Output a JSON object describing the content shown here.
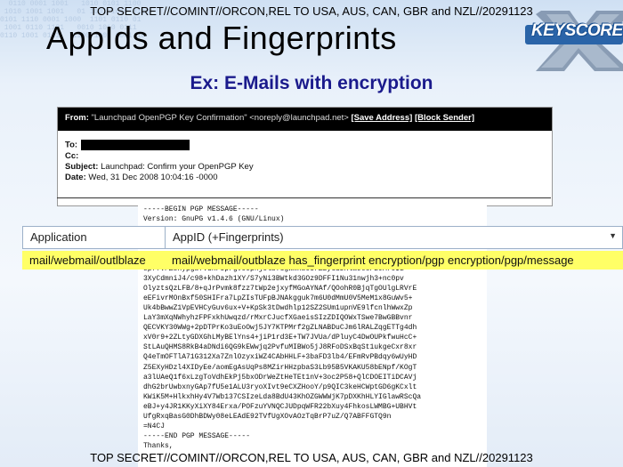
{
  "classification": "TOP SECRET//COMINT//ORCON,REL TO USA, AUS, CAN, GBR and NZL//20291123",
  "title": "AppIds and Fingerprints",
  "subtitle": "Ex: E-Mails with encryption",
  "logo": {
    "text": "KEYSCORE",
    "icon": "keyscore-x-logo"
  },
  "email": {
    "from_label": "From:",
    "from_value": "\"Launchpad OpenPGP Key Confirmation\" <noreply@launchpad.net>",
    "save_address": "[Save Address]",
    "block_sender": "[Block Sender]",
    "to_label": "To:",
    "cc_label": "Cc:",
    "subject_label": "Subject:",
    "subject_value": "Launchpad: Confirm your OpenPGP Key",
    "date_label": "Date:",
    "date_value": "Wed, 31 Dec 2008 10:04:16 -0000"
  },
  "grid": {
    "headers": [
      "Application",
      "AppID (+Fingerprints)"
    ],
    "row": [
      "mail/webmail/outlblaze",
      "mail/webmail/outblaze has_fingerprint encryption/pgp encryption/pgp/message"
    ]
  },
  "pgp_lines": [
    "-----BEGIN PGP MESSAGE-----",
    "Version: GnuPG v1.4.6 (GNU/Linux)",
    "",
    "",
    "",
    "",
    "spffVPZsHypgb7VdHFUprgvOJpnjOlb73gWmhbOUrZzyGdDRla9CcFzJA7OIL",
    "3XyCdmniJ4/c98+khDazh1XY/S7yNi3BWtkd3GOz9DFFI1Nu31nwjh3+nc0pv",
    "OlyztsQzLFB/8+qJrPvmk8fzz7tWp2ejxyfMGoAYNAf/QOohR0BjqTgOUlgLRVrE",
    "eEFivrMOnBxf50SHIFra7LpZIsTUFpBJNAkgguk7m6U0dMmU0V5MeM1x8GuWv5+",
    "Uk4bBwwZ1VpEVHCyGuv6ux+V+KpSk3tDwdhlp12SZ2SUm1upnVE9lfcnlhWwxZp",
    "LaY3mXqNWhyhzFPFxkhUwqzd/rMxrCJucfXGaeisSIzZDIQOWxTSwe7BwGBBvnr",
    "QECVKY30WWg+2pDTPrKo3uEoOwj5JY7KTPMrf2gZLNABDuCJm6lRALZqgETTg4dh",
    "xV0r9+2ZLtyGDXGhLMyBElYns4+jiP1rd3E+TW7JVUa/dPluyC4DwOUPkfwuHcC+",
    "StLAuQHMS8RkB4aDNdi6QG9kEWwjq2PvfuMIBWo5jJ8RFoDSxBqSt1ukgeCxr8xr",
    "Q4eTmOFTlA71G312Xa7ZnlOzyxiWZ4CAbHHLF+3baFD3lb4/EFmRvPBdqy6wUyHD",
    "Z5EXyHDzl4XIDyEe/aomEgAsUqPs8MZirHHzpbaS3Lb95B5VKAKU58bENpf/KOgT",
    "a3lUAeQ1f6xLzgToVdhEkPj5bxODrWeZtHeTEt1nV+3oc2P58+QlCDOEITiDCAVj",
    "dhG2brUwbxnyGAp7fU5e1ALU3ryoXIvt9eCXZHooY/p9QIC3keHCWptGD6gKCxlt",
    "KWiK5M+HlkxhHy4V7Wb137CSIzeLda8BdU43KhOZGWWWjK7pDXKhHLYIGlawRScQa",
    "eBJ+y4JR1KKyXiXY84Erxa/POFzuYVNQCJUDpqWFR22bXuy4FhkosLWMBG+UBHVt",
    "UfgRxqBasG0DhBDWy08eLEAdE92TVfUgXOvAOzTqBrP7uZ/Q7ABFFGTQ9n",
    "=N4CJ",
    "-----END PGP MESSAGE-----",
    "Thanks,"
  ]
}
